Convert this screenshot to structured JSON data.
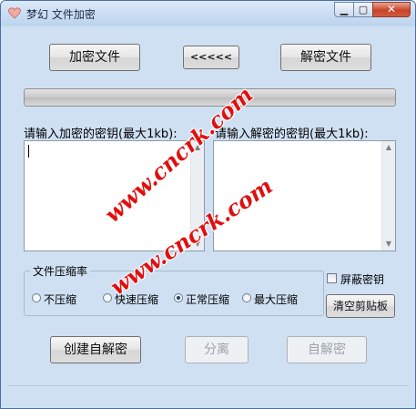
{
  "window": {
    "title": "梦幻 文件加密",
    "icon": "heart-app-icon",
    "minimize_glyph": "▁",
    "maximize_glyph": "▢",
    "close_glyph": "✕"
  },
  "toolbar": {
    "encrypt_label": "加密文件",
    "swap_label": "<<<<<",
    "decrypt_label": "解密文件"
  },
  "progress": {
    "percent": 0,
    "fill_color": "#3ab24a"
  },
  "left_key": {
    "label": "请输入加密的密钥(最大1kb):",
    "value": ""
  },
  "right_key": {
    "label": "请输入解密的密钥(最大1kb):",
    "value": ""
  },
  "compression": {
    "title": "文件压缩率",
    "options": [
      {
        "label": "不压缩",
        "checked": false
      },
      {
        "label": "快速压缩",
        "checked": false
      },
      {
        "label": "正常压缩",
        "checked": true
      },
      {
        "label": "最大压缩",
        "checked": false
      }
    ]
  },
  "hide_key": {
    "label": "屏蔽密钥",
    "checked": false
  },
  "buttons": {
    "clear_clipboard": "清空剪贴板",
    "create_self_extract": "创建自解密",
    "split": "分离",
    "self_decrypt": "自解密"
  },
  "watermark": {
    "text": "www.cncrk.com",
    "color": "#e01010"
  }
}
